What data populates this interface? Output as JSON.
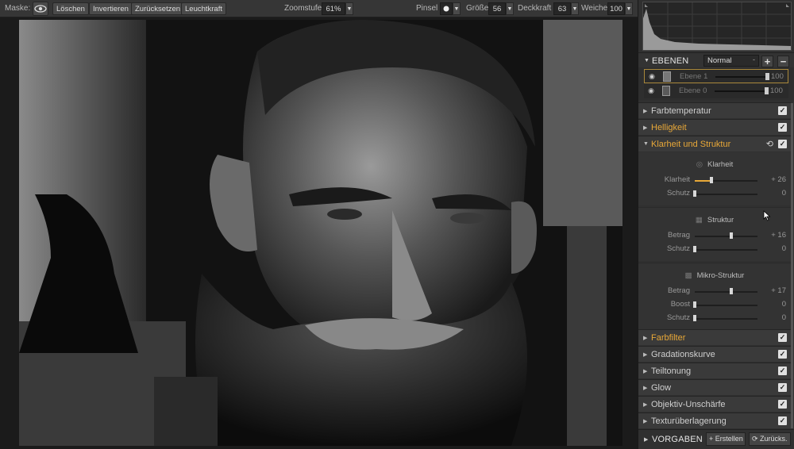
{
  "toolbar": {
    "mask_label": "Maske:",
    "btn_delete": "Löschen",
    "btn_invert": "Invertieren",
    "btn_reset": "Zurücksetzen",
    "btn_luminosity": "Leuchtkraft",
    "zoom_label": "Zoomstufe",
    "zoom_value": "61%",
    "brush_label": "Pinsel",
    "size_label": "Größe",
    "size_value": "56",
    "opacity_label": "Deckkraft",
    "opacity_value": "63",
    "softness_label": "Weiche",
    "softness_value": "100"
  },
  "layers": {
    "title": "EBENEN",
    "blend_mode": "Normal",
    "items": [
      {
        "name": "Ebene 1",
        "value": "100"
      },
      {
        "name": "Ebene 0",
        "value": "100"
      }
    ]
  },
  "filters": {
    "farbtemperatur": "Farbtemperatur",
    "helligkeit": "Helligkeit",
    "klarheit_struktur": "Klarheit und Struktur",
    "klarheit": {
      "title": "Klarheit",
      "rows": [
        {
          "label": "Klarheit",
          "value": "+ 26",
          "level": 26
        },
        {
          "label": "Schutz",
          "value": "0",
          "level": 0
        }
      ]
    },
    "struktur": {
      "title": "Struktur",
      "rows": [
        {
          "label": "Betrag",
          "value": "+ 16",
          "level": 16
        },
        {
          "label": "Schutz",
          "value": "0",
          "level": 0
        }
      ]
    },
    "mikro": {
      "title": "Mikro-Struktur",
      "rows": [
        {
          "label": "Betrag",
          "value": "+ 17",
          "level": 17
        },
        {
          "label": "Boost",
          "value": "0",
          "level": 0
        },
        {
          "label": "Schutz",
          "value": "0",
          "level": 0
        }
      ]
    },
    "farbfilter": "Farbfilter",
    "gradationskurve": "Gradationskurve",
    "teiltonung": "Teiltonung",
    "glow": "Glow",
    "objektiv": "Objektiv-Unschärfe",
    "textur": "Texturüberlagerung"
  },
  "presets": {
    "title": "VORGABEN",
    "create": "Erstellen",
    "back": "Zurücks."
  },
  "colors": {
    "accent": "#e8a838",
    "panel": "#303030"
  }
}
